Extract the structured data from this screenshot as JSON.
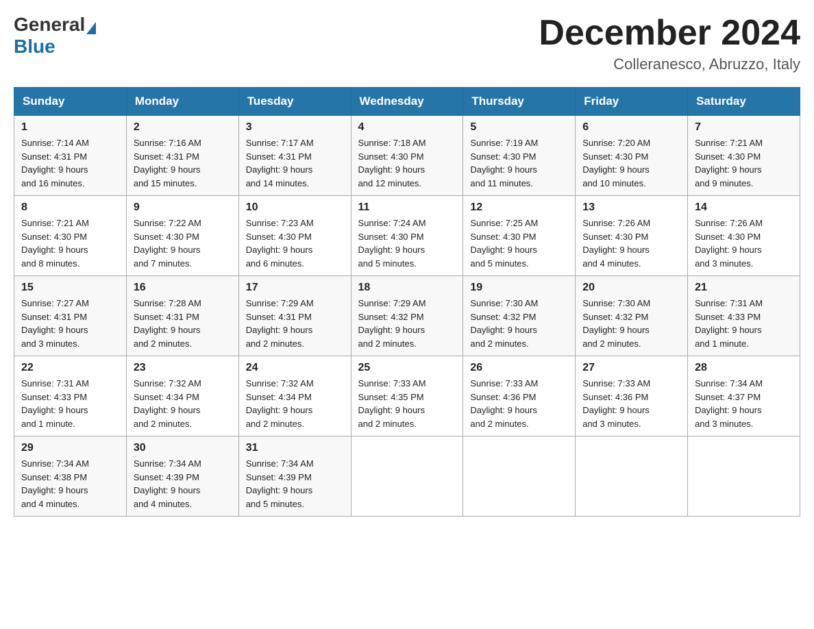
{
  "logo": {
    "general": "General",
    "blue": "Blue"
  },
  "title": "December 2024",
  "subtitle": "Colleranesco, Abruzzo, Italy",
  "days_of_week": [
    "Sunday",
    "Monday",
    "Tuesday",
    "Wednesday",
    "Thursday",
    "Friday",
    "Saturday"
  ],
  "weeks": [
    [
      {
        "day": "1",
        "sunrise": "7:14 AM",
        "sunset": "4:31 PM",
        "daylight": "9 hours and 16 minutes."
      },
      {
        "day": "2",
        "sunrise": "7:16 AM",
        "sunset": "4:31 PM",
        "daylight": "9 hours and 15 minutes."
      },
      {
        "day": "3",
        "sunrise": "7:17 AM",
        "sunset": "4:31 PM",
        "daylight": "9 hours and 14 minutes."
      },
      {
        "day": "4",
        "sunrise": "7:18 AM",
        "sunset": "4:30 PM",
        "daylight": "9 hours and 12 minutes."
      },
      {
        "day": "5",
        "sunrise": "7:19 AM",
        "sunset": "4:30 PM",
        "daylight": "9 hours and 11 minutes."
      },
      {
        "day": "6",
        "sunrise": "7:20 AM",
        "sunset": "4:30 PM",
        "daylight": "9 hours and 10 minutes."
      },
      {
        "day": "7",
        "sunrise": "7:21 AM",
        "sunset": "4:30 PM",
        "daylight": "9 hours and 9 minutes."
      }
    ],
    [
      {
        "day": "8",
        "sunrise": "7:21 AM",
        "sunset": "4:30 PM",
        "daylight": "9 hours and 8 minutes."
      },
      {
        "day": "9",
        "sunrise": "7:22 AM",
        "sunset": "4:30 PM",
        "daylight": "9 hours and 7 minutes."
      },
      {
        "day": "10",
        "sunrise": "7:23 AM",
        "sunset": "4:30 PM",
        "daylight": "9 hours and 6 minutes."
      },
      {
        "day": "11",
        "sunrise": "7:24 AM",
        "sunset": "4:30 PM",
        "daylight": "9 hours and 5 minutes."
      },
      {
        "day": "12",
        "sunrise": "7:25 AM",
        "sunset": "4:30 PM",
        "daylight": "9 hours and 5 minutes."
      },
      {
        "day": "13",
        "sunrise": "7:26 AM",
        "sunset": "4:30 PM",
        "daylight": "9 hours and 4 minutes."
      },
      {
        "day": "14",
        "sunrise": "7:26 AM",
        "sunset": "4:30 PM",
        "daylight": "9 hours and 3 minutes."
      }
    ],
    [
      {
        "day": "15",
        "sunrise": "7:27 AM",
        "sunset": "4:31 PM",
        "daylight": "9 hours and 3 minutes."
      },
      {
        "day": "16",
        "sunrise": "7:28 AM",
        "sunset": "4:31 PM",
        "daylight": "9 hours and 2 minutes."
      },
      {
        "day": "17",
        "sunrise": "7:29 AM",
        "sunset": "4:31 PM",
        "daylight": "9 hours and 2 minutes."
      },
      {
        "day": "18",
        "sunrise": "7:29 AM",
        "sunset": "4:32 PM",
        "daylight": "9 hours and 2 minutes."
      },
      {
        "day": "19",
        "sunrise": "7:30 AM",
        "sunset": "4:32 PM",
        "daylight": "9 hours and 2 minutes."
      },
      {
        "day": "20",
        "sunrise": "7:30 AM",
        "sunset": "4:32 PM",
        "daylight": "9 hours and 2 minutes."
      },
      {
        "day": "21",
        "sunrise": "7:31 AM",
        "sunset": "4:33 PM",
        "daylight": "9 hours and 1 minute."
      }
    ],
    [
      {
        "day": "22",
        "sunrise": "7:31 AM",
        "sunset": "4:33 PM",
        "daylight": "9 hours and 1 minute."
      },
      {
        "day": "23",
        "sunrise": "7:32 AM",
        "sunset": "4:34 PM",
        "daylight": "9 hours and 2 minutes."
      },
      {
        "day": "24",
        "sunrise": "7:32 AM",
        "sunset": "4:34 PM",
        "daylight": "9 hours and 2 minutes."
      },
      {
        "day": "25",
        "sunrise": "7:33 AM",
        "sunset": "4:35 PM",
        "daylight": "9 hours and 2 minutes."
      },
      {
        "day": "26",
        "sunrise": "7:33 AM",
        "sunset": "4:36 PM",
        "daylight": "9 hours and 2 minutes."
      },
      {
        "day": "27",
        "sunrise": "7:33 AM",
        "sunset": "4:36 PM",
        "daylight": "9 hours and 3 minutes."
      },
      {
        "day": "28",
        "sunrise": "7:34 AM",
        "sunset": "4:37 PM",
        "daylight": "9 hours and 3 minutes."
      }
    ],
    [
      {
        "day": "29",
        "sunrise": "7:34 AM",
        "sunset": "4:38 PM",
        "daylight": "9 hours and 4 minutes."
      },
      {
        "day": "30",
        "sunrise": "7:34 AM",
        "sunset": "4:39 PM",
        "daylight": "9 hours and 4 minutes."
      },
      {
        "day": "31",
        "sunrise": "7:34 AM",
        "sunset": "4:39 PM",
        "daylight": "9 hours and 5 minutes."
      },
      null,
      null,
      null,
      null
    ]
  ],
  "labels": {
    "sunrise": "Sunrise:",
    "sunset": "Sunset:",
    "daylight": "Daylight:"
  }
}
